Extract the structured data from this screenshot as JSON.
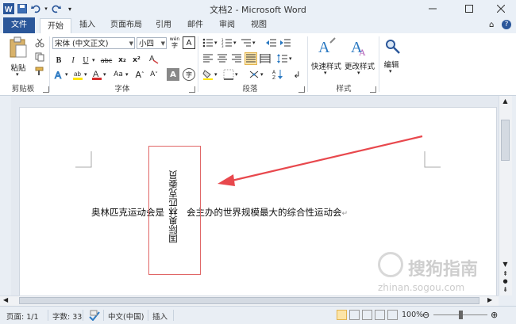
{
  "window": {
    "title": "文档2 - Microsoft Word"
  },
  "tabs": [
    {
      "label": "文件"
    },
    {
      "label": "开始"
    },
    {
      "label": "插入"
    },
    {
      "label": "页面布局"
    },
    {
      "label": "引用"
    },
    {
      "label": "邮件"
    },
    {
      "label": "审阅"
    },
    {
      "label": "视图"
    }
  ],
  "ribbon": {
    "clipboard": {
      "paste": "粘贴",
      "group": "剪贴板"
    },
    "font": {
      "font_name": "宋体 (中文正文)",
      "font_size": "小四",
      "group": "字体",
      "bold": "B",
      "italic": "I",
      "underline": "U",
      "strike": "abc",
      "sub": "x₂",
      "sup": "x²",
      "grow": "A",
      "shrink": "A",
      "case": "Aa",
      "clear": "A",
      "char_border": "A",
      "phonetic": "wén",
      "enclose": "字"
    },
    "paragraph": {
      "group": "段落"
    },
    "styles": {
      "quick": "快速样式",
      "change": "更改样式",
      "group": "样式"
    },
    "editing": {
      "label": "编辑"
    }
  },
  "document": {
    "body_text": "奥林匹克运动会是",
    "body_text_2": "会主办的世界规模最大的综合性运动会",
    "return_mark": "↵",
    "vertical_text": "国际奥林匹克委员"
  },
  "statusbar": {
    "page": "页面: 1/1",
    "words": "字数: 33",
    "language": "中文(中国)",
    "mode": "插入",
    "zoom": "100%"
  },
  "watermark": {
    "brand": "搜狗指南",
    "url": "zhinan.sogou.com"
  },
  "colors": {
    "file_tab": "#2b579a",
    "arrow": "#e8484d",
    "textbox_border": "#e06666",
    "font_color": "#d42a2a",
    "highlight": "#ffe600"
  }
}
